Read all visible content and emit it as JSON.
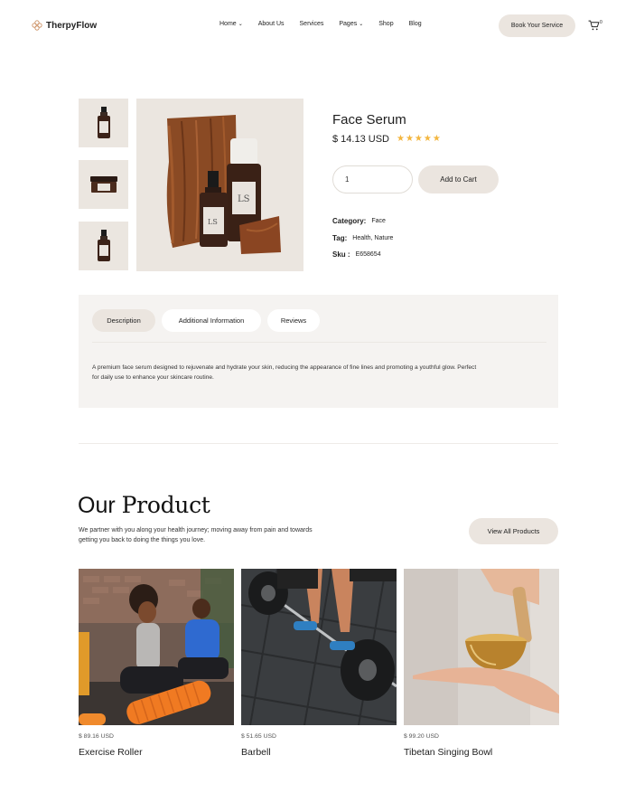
{
  "header": {
    "brand": "TherpyFlow",
    "nav": [
      {
        "label": "Home",
        "has_dropdown": true
      },
      {
        "label": "About Us",
        "has_dropdown": false
      },
      {
        "label": "Services",
        "has_dropdown": false
      },
      {
        "label": "Pages",
        "has_dropdown": true
      },
      {
        "label": "Shop",
        "has_dropdown": false
      },
      {
        "label": "Blog",
        "has_dropdown": false
      }
    ],
    "book_button": "Book Your Service",
    "cart_count": "0"
  },
  "product": {
    "title": "Face Serum",
    "price": "$ 14.13 USD",
    "rating_stars": "★★★★★",
    "rating": 5,
    "quantity": "1",
    "add_to_cart": "Add to Cart",
    "category_label": "Category:",
    "category_value": "Face",
    "tag_label": "Tag:",
    "tag_value": "Health, Nature",
    "sku_label": "Sku :",
    "sku_value": "E658654"
  },
  "tabs": {
    "items": [
      "Description",
      "Additional Information",
      "Reviews"
    ],
    "active": "Description",
    "description": "A premium face serum designed to rejuvenate and hydrate your skin, reducing the appearance of fine lines and promoting a youthful glow. Perfect for daily use to enhance your skincare routine."
  },
  "our_product": {
    "title_bold": "Our",
    "title_serif": "Product",
    "subtitle": "We partner with you along your health journey; moving away from pain and towards getting you back to doing the things you love.",
    "view_all": "View All Products",
    "cards": [
      {
        "price": "$ 89.16 USD",
        "name": "Exercise Roller"
      },
      {
        "price": "$ 51.65 USD",
        "name": "Barbell"
      },
      {
        "price": "$ 99.20 USD",
        "name": "Tibetan Singing Bowl"
      }
    ]
  },
  "colors": {
    "accent_beige": "#ebe5df",
    "panel_bg": "#f5f3f1",
    "star": "#f3b63f",
    "brand_icon": "#c98a5b"
  }
}
